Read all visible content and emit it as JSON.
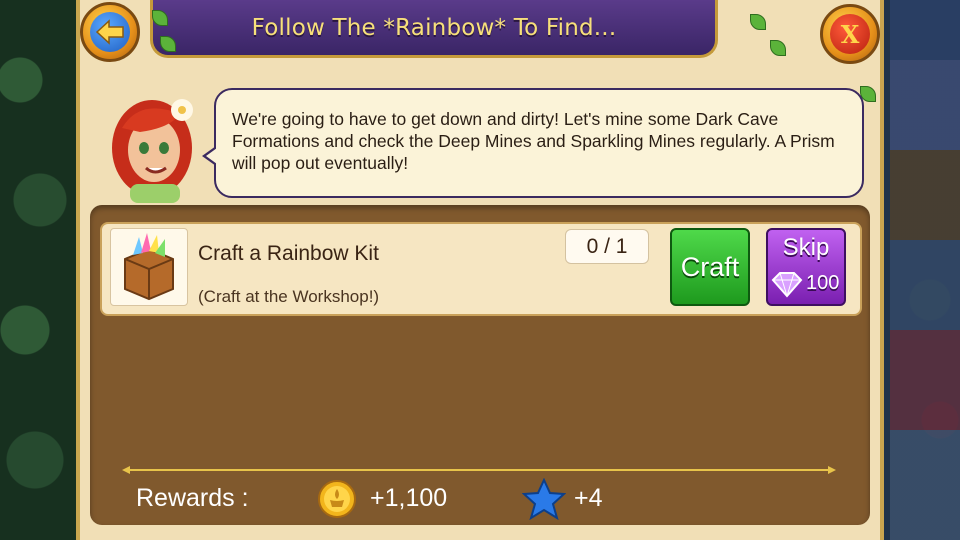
{
  "dialog": {
    "title": "Follow The *Rainbow* To Find...",
    "back_icon": "back-arrow-icon",
    "close_icon": "close-x-icon",
    "close_glyph": "X"
  },
  "npc": {
    "avatar": "red-haired-woman-avatar",
    "message": "We're going to have to get down and dirty! Let's mine some Dark Cave Formations and check the Deep Mines and Sparkling Mines regularly. A Prism will pop out eventually!"
  },
  "task": {
    "icon": "rainbow-kit-crate-icon",
    "title": "Craft a Rainbow Kit",
    "subtitle": "(Craft at the Workshop!)",
    "progress": "0 / 1",
    "craft_label": "Craft",
    "skip_label": "Skip",
    "skip_cost": "100",
    "skip_currency_icon": "gem-icon"
  },
  "rewards": {
    "label": "Rewards :",
    "coins_icon": "coin-icon",
    "coins": "+1,100",
    "xp_icon": "star-icon",
    "xp": "+4"
  },
  "colors": {
    "title_bg": "#4a2f7a",
    "title_text": "#f7e07a",
    "panel_bg": "#f1dfb6",
    "task_area_bg": "#80592d",
    "craft_green": "#2fb82a",
    "skip_purple": "#9a35d0"
  }
}
